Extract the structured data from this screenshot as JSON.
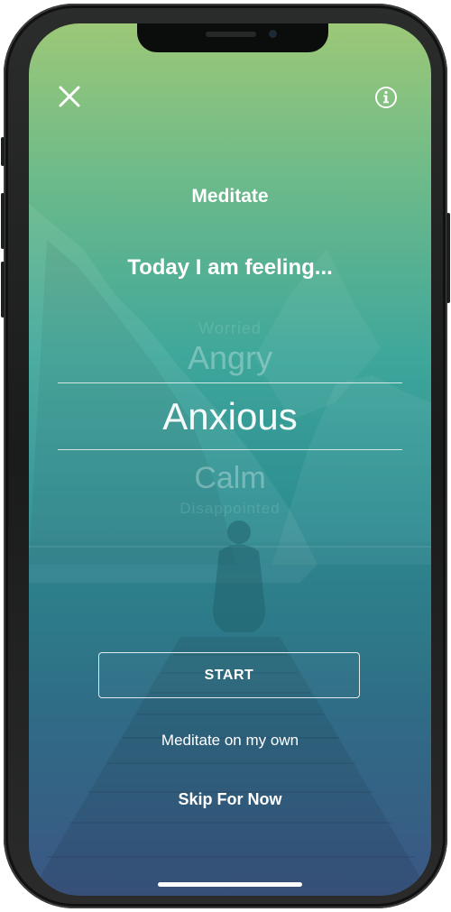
{
  "header": {
    "close_icon": "close-icon",
    "info_icon": "info-icon",
    "title": "Meditate"
  },
  "prompt": "Today I am feeling...",
  "picker": {
    "options": [
      "Worried",
      "Angry",
      "Anxious",
      "Calm",
      "Disappointed"
    ],
    "selected": "Anxious"
  },
  "actions": {
    "start_label": "START",
    "own_label": "Meditate on my own",
    "skip_label": "Skip For Now"
  },
  "colors": {
    "gradient_top": "#9cc877",
    "gradient_mid": "#2d8f92",
    "gradient_bottom": "#3b5683",
    "text": "#ffffff"
  }
}
